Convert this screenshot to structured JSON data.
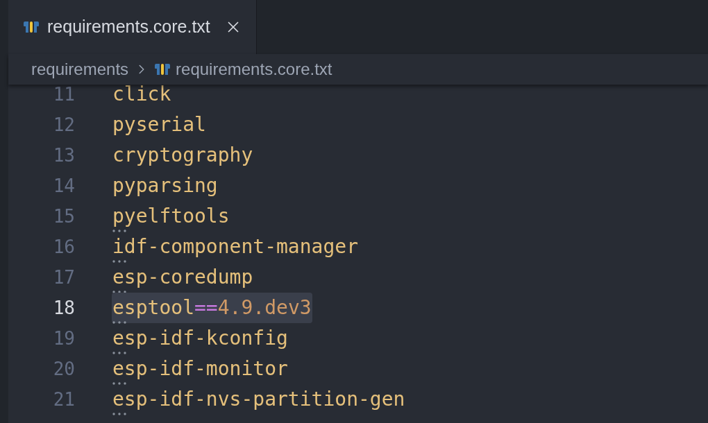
{
  "tabs": [
    {
      "label": "requirements.core.txt",
      "selected": true
    }
  ],
  "breadcrumb": [
    "requirements",
    "requirements.core.txt"
  ],
  "lines": [
    {
      "number": "11",
      "current": false,
      "hint": false,
      "tokens": [
        {
          "kind": "package",
          "text": "click"
        }
      ]
    },
    {
      "number": "12",
      "current": false,
      "hint": false,
      "tokens": [
        {
          "kind": "package",
          "text": "pyserial"
        }
      ]
    },
    {
      "number": "13",
      "current": false,
      "hint": false,
      "tokens": [
        {
          "kind": "package",
          "text": "cryptography"
        }
      ]
    },
    {
      "number": "14",
      "current": false,
      "hint": false,
      "tokens": [
        {
          "kind": "package",
          "text": "pyparsing"
        }
      ]
    },
    {
      "number": "15",
      "current": false,
      "hint": true,
      "tokens": [
        {
          "kind": "package",
          "text": "pyelftools"
        }
      ]
    },
    {
      "number": "16",
      "current": false,
      "hint": true,
      "tokens": [
        {
          "kind": "package",
          "text": "idf-component-manager"
        }
      ]
    },
    {
      "number": "17",
      "current": false,
      "hint": true,
      "tokens": [
        {
          "kind": "package",
          "text": "esp-coredump"
        }
      ]
    },
    {
      "number": "18",
      "current": true,
      "hint": true,
      "tokens": [
        {
          "kind": "package",
          "text": "esptool"
        },
        {
          "kind": "operator",
          "text": "=="
        },
        {
          "kind": "version",
          "text": "4.9.dev3"
        }
      ]
    },
    {
      "number": "19",
      "current": false,
      "hint": true,
      "tokens": [
        {
          "kind": "package",
          "text": "esp-idf-kconfig"
        }
      ]
    },
    {
      "number": "20",
      "current": false,
      "hint": true,
      "tokens": [
        {
          "kind": "package",
          "text": "esp-idf-monitor"
        }
      ]
    },
    {
      "number": "21",
      "current": false,
      "hint": true,
      "tokens": [
        {
          "kind": "package",
          "text": "esp-idf-nvs-partition-gen"
        }
      ]
    }
  ]
}
